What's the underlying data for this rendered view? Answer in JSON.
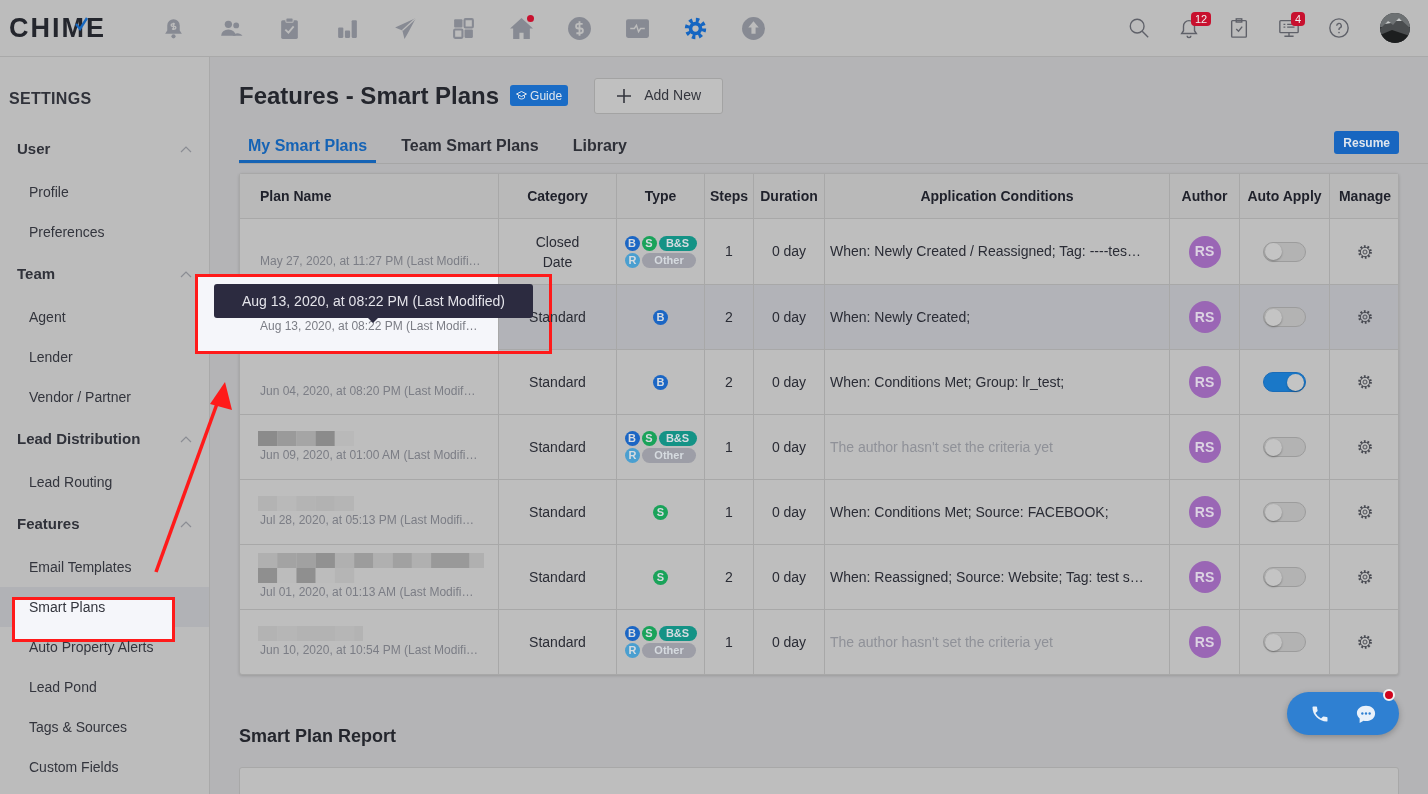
{
  "logo": "CHIME",
  "nav_icons": [
    {
      "selected": false,
      "dot": false
    },
    {
      "selected": false,
      "dot": false
    },
    {
      "selected": false,
      "dot": false
    },
    {
      "selected": false,
      "dot": false
    },
    {
      "selected": false,
      "dot": false
    },
    {
      "selected": false,
      "dot": false
    },
    {
      "selected": false,
      "dot": true
    },
    {
      "selected": false,
      "dot": false
    },
    {
      "selected": false,
      "dot": false
    },
    {
      "selected": true,
      "dot": false
    },
    {
      "selected": false,
      "dot": false
    }
  ],
  "toolbar": {
    "notifications": "12",
    "messages": "4"
  },
  "sidebar": {
    "title": "SETTINGS",
    "groups": [
      {
        "label": "User",
        "expanded": true,
        "items": [
          {
            "label": "Profile",
            "selected": false
          },
          {
            "label": "Preferences",
            "selected": false
          }
        ]
      },
      {
        "label": "Team",
        "expanded": true,
        "items": [
          {
            "label": "Agent",
            "selected": false
          },
          {
            "label": "Lender",
            "selected": false
          },
          {
            "label": "Vendor / Partner",
            "selected": false
          }
        ]
      },
      {
        "label": "Lead Distribution",
        "expanded": true,
        "items": [
          {
            "label": "Lead Routing",
            "selected": false
          }
        ]
      },
      {
        "label": "Features",
        "expanded": true,
        "items": [
          {
            "label": "Email Templates",
            "selected": false
          },
          {
            "label": "Smart Plans",
            "selected": true
          },
          {
            "label": "Auto Property Alerts",
            "selected": false
          },
          {
            "label": "Lead Pond",
            "selected": false
          },
          {
            "label": "Tags & Sources",
            "selected": false
          },
          {
            "label": "Custom Fields",
            "selected": false
          }
        ]
      }
    ]
  },
  "page": {
    "title": "Features - Smart Plans",
    "guide": "Guide",
    "add_button": "Add New",
    "resume": "Resume"
  },
  "tabs": [
    {
      "label": "My Smart Plans",
      "selected": true
    },
    {
      "label": "Team Smart Plans",
      "selected": false
    },
    {
      "label": "Library",
      "selected": false
    }
  ],
  "table": {
    "columns": [
      "Plan Name",
      "Category",
      "Type",
      "Steps",
      "Duration",
      "Application Conditions",
      "Author",
      "Auto Apply",
      "Manage"
    ],
    "rows": [
      {
        "redacted": false,
        "date": "May 27, 2020, at 11:27 PM (Last Modifi…",
        "category": "Closed Date",
        "types": [
          {
            "label": "B",
            "kind": "b"
          },
          {
            "label": "S",
            "kind": "s"
          },
          {
            "label": "B&S",
            "kind": "bs"
          },
          {
            "label": "R",
            "kind": "r"
          },
          {
            "label": "Other",
            "kind": "other"
          }
        ],
        "steps": "1",
        "duration": "0 day",
        "conditions": "When: Newly Created / Reassigned; Tag: ----tes…",
        "conditions_set": true,
        "author": "RS",
        "auto_apply": false,
        "selected": false
      },
      {
        "redacted": false,
        "date": "Aug 13, 2020, at 08:22 PM (Last Modif…",
        "category": "Standard",
        "types": [
          {
            "label": "B",
            "kind": "b"
          }
        ],
        "steps": "2",
        "duration": "0 day",
        "conditions": "When: Newly Created;",
        "conditions_set": true,
        "author": "RS",
        "auto_apply": false,
        "selected": true
      },
      {
        "redacted": false,
        "date": "Jun 04, 2020, at 08:20 PM (Last Modif…",
        "category": "Standard",
        "types": [
          {
            "label": "B",
            "kind": "b"
          }
        ],
        "steps": "2",
        "duration": "0 day",
        "conditions": "When: Conditions Met; Group: lr_test;",
        "conditions_set": true,
        "author": "RS",
        "auto_apply": true,
        "selected": false
      },
      {
        "redacted": true,
        "date": "Jun 09, 2020, at 01:00 AM (Last Modifi…",
        "category": "Standard",
        "types": [
          {
            "label": "B",
            "kind": "b"
          },
          {
            "label": "S",
            "kind": "s"
          },
          {
            "label": "B&S",
            "kind": "bs"
          },
          {
            "label": "R",
            "kind": "r"
          },
          {
            "label": "Other",
            "kind": "other"
          }
        ],
        "steps": "1",
        "duration": "0 day",
        "conditions": "The author hasn't set the criteria yet",
        "conditions_set": false,
        "author": "RS",
        "auto_apply": false,
        "selected": false
      },
      {
        "redacted": true,
        "date": "Jul 28, 2020, at 05:13 PM (Last Modifi…",
        "category": "Standard",
        "types": [
          {
            "label": "S",
            "kind": "s"
          }
        ],
        "steps": "1",
        "duration": "0 day",
        "conditions": "When: Conditions Met; Source: FACEBOOK;",
        "conditions_set": true,
        "author": "RS",
        "auto_apply": false,
        "selected": false
      },
      {
        "redacted": true,
        "date": "Jul 01, 2020, at 01:13 AM (Last Modifi…",
        "category": "Standard",
        "types": [
          {
            "label": "S",
            "kind": "s"
          }
        ],
        "steps": "2",
        "duration": "0 day",
        "conditions": "When: Reassigned; Source: Website; Tag: test s…",
        "conditions_set": true,
        "author": "RS",
        "auto_apply": false,
        "selected": false
      },
      {
        "redacted": true,
        "date": "Jun 10, 2020, at 10:54 PM (Last Modifi…",
        "category": "Standard",
        "types": [
          {
            "label": "B",
            "kind": "b"
          },
          {
            "label": "S",
            "kind": "s"
          },
          {
            "label": "B&S",
            "kind": "bs"
          },
          {
            "label": "R",
            "kind": "r"
          },
          {
            "label": "Other",
            "kind": "other"
          }
        ],
        "steps": "1",
        "duration": "0 day",
        "conditions": "The author hasn't set the criteria yet",
        "conditions_set": false,
        "author": "RS",
        "auto_apply": false,
        "selected": false
      }
    ]
  },
  "tooltip": "Aug 13, 2020, at 08:22 PM (Last Modified)",
  "report": {
    "title": "Smart Plan Report"
  }
}
